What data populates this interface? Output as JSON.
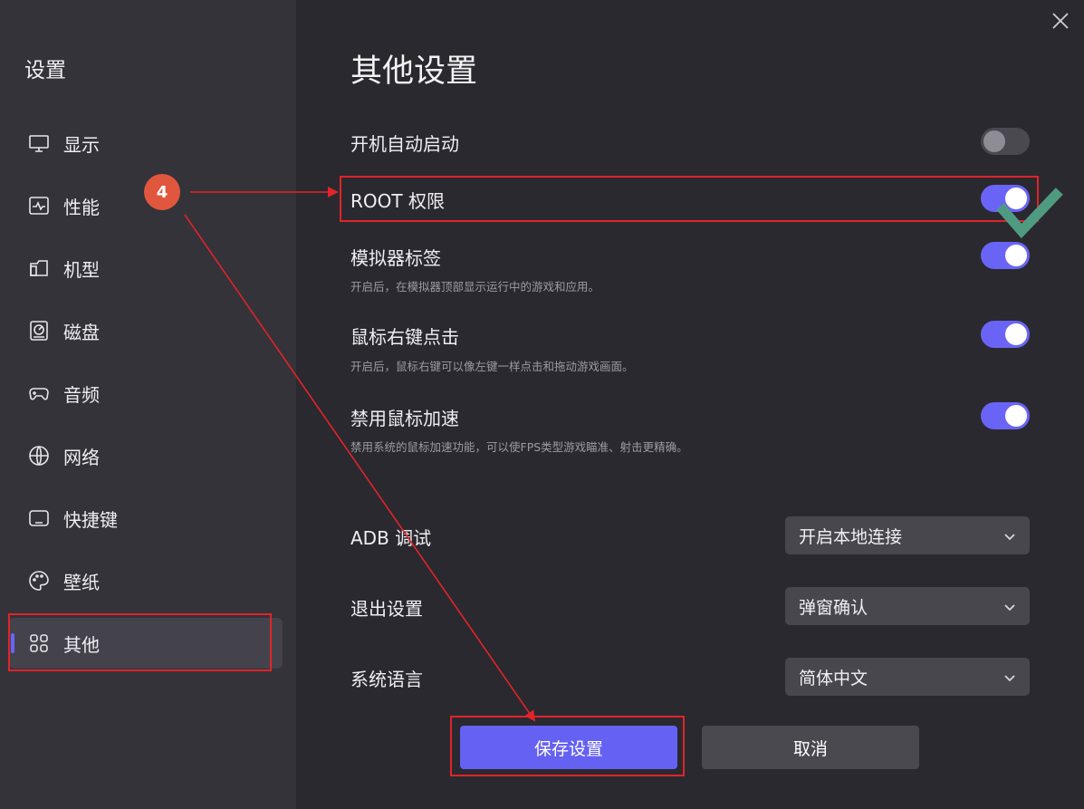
{
  "sidebar": {
    "title": "设置",
    "items": [
      {
        "label": "显示"
      },
      {
        "label": "性能"
      },
      {
        "label": "机型"
      },
      {
        "label": "磁盘"
      },
      {
        "label": "音频"
      },
      {
        "label": "网络"
      },
      {
        "label": "快捷键"
      },
      {
        "label": "壁纸"
      },
      {
        "label": "其他"
      }
    ],
    "active_item": "其他"
  },
  "main": {
    "title": "其他设置",
    "toggles": [
      {
        "label": "开机自动启动",
        "on": false
      },
      {
        "label": "ROOT 权限",
        "on": true
      },
      {
        "label": "模拟器标签",
        "description": "开启后，在模拟器顶部显示运行中的游戏和应用。",
        "on": true
      },
      {
        "label": "鼠标右键点击",
        "description": "开启后，鼠标右键可以像左键一样点击和拖动游戏画面。",
        "on": true
      },
      {
        "label": "禁用鼠标加速",
        "description": "禁用系统的鼠标加速功能，可以使FPS类型游戏瞄准、射击更精确。",
        "on": true
      }
    ],
    "selects": [
      {
        "label": "ADB 调试",
        "value": "开启本地连接"
      },
      {
        "label": "退出设置",
        "value": "弹窗确认"
      },
      {
        "label": "系统语言",
        "value": "简体中文"
      }
    ],
    "save_label": "保存设置",
    "cancel_label": "取消"
  },
  "annotation": {
    "step_number": "4",
    "highlight_color": "#e0242a",
    "check_color": "#4f9b82"
  },
  "colors": {
    "accent": "#6561f2",
    "toggle_on": "#6a64f6",
    "background": "#2a292f",
    "sidebar": "#343339"
  }
}
